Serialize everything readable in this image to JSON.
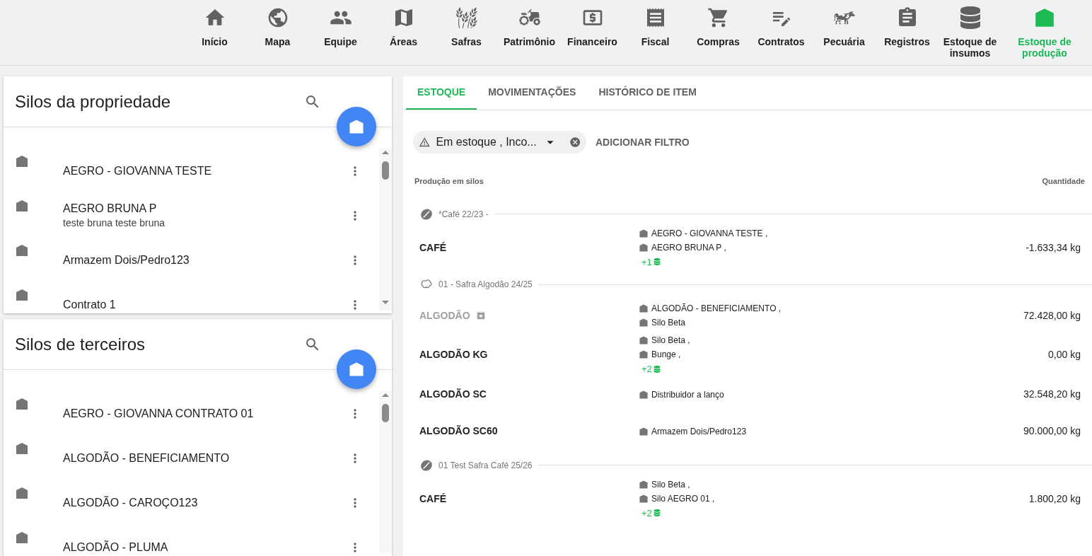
{
  "nav": [
    {
      "label": "Início",
      "selected": false
    },
    {
      "label": "Mapa",
      "selected": false
    },
    {
      "label": "Equipe",
      "selected": false
    },
    {
      "label": "Áreas",
      "selected": false
    },
    {
      "label": "Safras",
      "selected": false
    },
    {
      "label": "Patrimônio",
      "selected": false
    },
    {
      "label": "Financeiro",
      "selected": false
    },
    {
      "label": "Fiscal",
      "selected": false
    },
    {
      "label": "Compras",
      "selected": false
    },
    {
      "label": "Contratos",
      "selected": false
    },
    {
      "label": "Pecuária",
      "selected": false
    },
    {
      "label": "Registros",
      "selected": false
    },
    {
      "label": "Estoque de insumos",
      "selected": false
    },
    {
      "label": "Estoque de produção",
      "selected": true
    }
  ],
  "panels": [
    {
      "title": "Silos da propriedade",
      "items": [
        {
          "name": "AEGRO - GIOVANNA TESTE"
        },
        {
          "name": "AEGRO BRUNA P",
          "description": "teste bruna teste bruna"
        },
        {
          "name": "Armazem Dois/Pedro123"
        },
        {
          "name": "Contrato 1"
        }
      ]
    },
    {
      "title": "Silos de terceiros",
      "items": [
        {
          "name": "AEGRO - GIOVANNA CONTRATO 01"
        },
        {
          "name": "ALGODÃO - BENEFICIAMENTO"
        },
        {
          "name": "ALGODÃO - CAROÇO123"
        },
        {
          "name": "ALGODÃO - PLUMA"
        }
      ]
    }
  ],
  "tabs": [
    {
      "label": "ESTOQUE",
      "selected": true
    },
    {
      "label": "MOVIMENTAÇÕES",
      "selected": false
    },
    {
      "label": "HISTÓRICO DE ITEM",
      "selected": false
    }
  ],
  "filter": {
    "value": "Em estoque , Inco...",
    "add_label": "ADICIONAR FILTRO"
  },
  "table": {
    "columns": [
      "Produção em silos",
      "Quantidade"
    ],
    "groups": [
      {
        "title": "*Café 22/23 -",
        "kind": "coffee",
        "rows": [
          {
            "product": "CAFÉ",
            "archived": false,
            "silos": [
              "AEGRO - GIOVANNA TESTE ,",
              "AEGRO BRUNA P ,"
            ],
            "more": "+1",
            "quantity": "-1.633,34 kg"
          }
        ]
      },
      {
        "title": "01 - Safra Algodão 24/25",
        "kind": "cotton",
        "rows": [
          {
            "product": "ALGODÃO",
            "archived": true,
            "silos": [
              "ALGODÃO - BENEFICIAMENTO ,",
              "Silo Beta"
            ],
            "quantity": "72.428,00 kg"
          },
          {
            "product": "ALGODÃO KG",
            "archived": false,
            "silos": [
              "Silo Beta ,",
              "Bunge ,"
            ],
            "more": "+2",
            "quantity": "0,00 kg"
          },
          {
            "product": "ALGODÃO SC",
            "archived": false,
            "silos": [
              "Distribuidor a lanço"
            ],
            "quantity": "32.548,20 kg"
          },
          {
            "product": "ALGODÃO SC60",
            "archived": false,
            "silos": [
              "Armazem Dois/Pedro123"
            ],
            "quantity": "90.000,00 kg"
          }
        ]
      },
      {
        "title": "01 Test Safra Café 25/26",
        "kind": "coffee",
        "rows": [
          {
            "product": "CAFÉ",
            "archived": false,
            "silos": [
              "Silo Beta ,",
              "Silo AEGRO 01 ,"
            ],
            "more": "+2",
            "quantity": "1.800,20 kg"
          }
        ]
      }
    ]
  }
}
